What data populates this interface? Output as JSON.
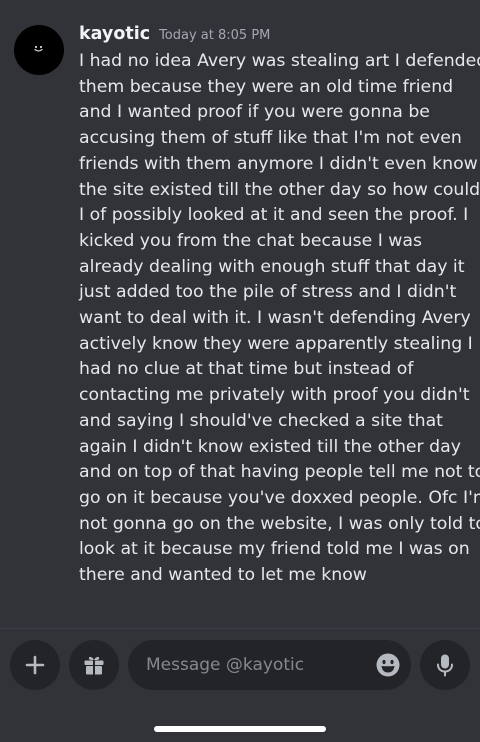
{
  "message": {
    "username": "kayotic",
    "timestamp": "Today at 8:05 PM",
    "lines": [
      "I had no idea Avery was stealing art I defended",
      "them because they were an old time friend",
      "and I wanted proof if you were gonna be",
      "accusing them of stuff like that I'm not even",
      "friends with them anymore I didn't even know",
      "the site existed till the other day so how could",
      "I of possibly looked at it and seen the proof. I",
      "kicked you from the chat because I was",
      "already dealing with enough stuff that day it",
      "just added too the pile of stress and I didn't",
      "want to deal with it. I wasn't defending Avery",
      "actively know they were apparently stealing I",
      "had no clue at that time but instead of",
      "contacting me privately with proof you didn't",
      "and saying I should've checked a site that",
      "again I didn't know existed till the other day",
      "and on top of that having people tell me not to",
      "go on it because you've doxxed people. Ofc I'm",
      "not gonna go on the website, I was only told to",
      "look at it because my friend told me I was on",
      "there and  wanted to let me know"
    ]
  },
  "composer": {
    "placeholder": "Message @kayotic",
    "add_icon": "plus-icon",
    "gift_icon": "gift-icon",
    "emoji_icon": "emoji-icon",
    "mic_icon": "microphone-icon"
  },
  "colors": {
    "background": "#313338",
    "button_background": "#232428",
    "text": "#e6e7ea",
    "muted": "#a5a8b0",
    "placeholder": "#85888f"
  }
}
